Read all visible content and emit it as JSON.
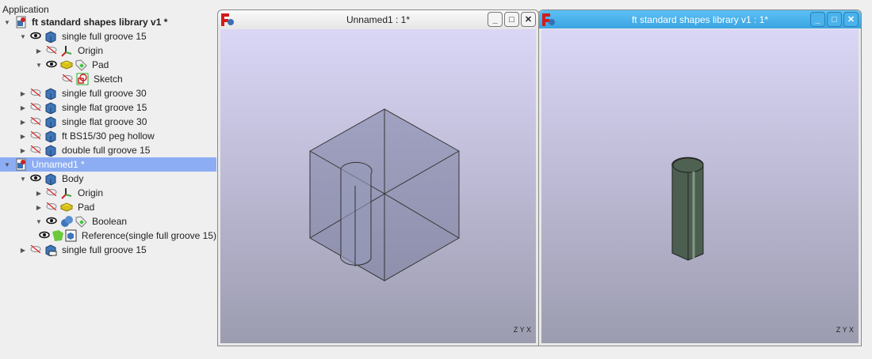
{
  "tree": {
    "header": "Application",
    "items": [
      {
        "label": "ft standard shapes library v1 *",
        "depth": 0,
        "arrow": "down",
        "icon": "document-icon",
        "bold": true
      },
      {
        "label": "single full groove 15",
        "depth": 1,
        "arrow": "down",
        "eye": "visible",
        "icon": "body-icon"
      },
      {
        "label": "Origin",
        "depth": 2,
        "arrow": "right",
        "eye": "hidden",
        "icon": "origin-icon"
      },
      {
        "label": "Pad",
        "depth": 2,
        "arrow": "down",
        "eye": "visible",
        "icon": "pad-icon",
        "tag": true
      },
      {
        "label": "Sketch",
        "depth": 3,
        "arrow": "",
        "eye": "hidden",
        "icon": "sketch-icon"
      },
      {
        "label": "single full groove 30",
        "depth": 1,
        "arrow": "right",
        "eye": "hidden",
        "icon": "body-icon"
      },
      {
        "label": "single flat groove 15",
        "depth": 1,
        "arrow": "right",
        "eye": "hidden",
        "icon": "body-icon"
      },
      {
        "label": "single flat groove 30",
        "depth": 1,
        "arrow": "right",
        "eye": "hidden",
        "icon": "body-icon"
      },
      {
        "label": "ft BS15/30 peg hollow",
        "depth": 1,
        "arrow": "right",
        "eye": "hidden",
        "icon": "body-icon"
      },
      {
        "label": "double full groove 15",
        "depth": 1,
        "arrow": "right",
        "eye": "hidden",
        "icon": "body-icon"
      },
      {
        "label": "Unnamed1 *",
        "depth": 0,
        "arrow": "down",
        "icon": "document-icon",
        "selected": true
      },
      {
        "label": "Body",
        "depth": 1,
        "arrow": "down",
        "eye": "visible",
        "icon": "body-icon"
      },
      {
        "label": "Origin",
        "depth": 2,
        "arrow": "right",
        "eye": "hidden",
        "icon": "origin-icon"
      },
      {
        "label": "Pad",
        "depth": 2,
        "arrow": "right",
        "eye": "hidden",
        "icon": "pad-icon"
      },
      {
        "label": "Boolean",
        "depth": 2,
        "arrow": "down",
        "eye": "visible",
        "icon": "boolean-icon",
        "tag": true
      },
      {
        "label": "Reference(single full groove 15)",
        "depth": 3,
        "arrow": "",
        "eye": "visible",
        "icon": "reference-icon"
      },
      {
        "label": "single full groove 15",
        "depth": 1,
        "arrow": "right",
        "eye": "hidden",
        "icon": "link-body-icon"
      }
    ]
  },
  "windows": {
    "left": {
      "title": "Unnamed1 : 1*"
    },
    "right": {
      "title": "ft standard shapes library v1 : 1*"
    }
  },
  "buttons": {
    "minimize": "_",
    "maximize": "□",
    "close": "✕"
  },
  "axes": {
    "z": "Z",
    "y": "Y",
    "x": "X"
  },
  "colors": {
    "active_title": "#4ab2ec",
    "selection": "#8cadf3"
  }
}
